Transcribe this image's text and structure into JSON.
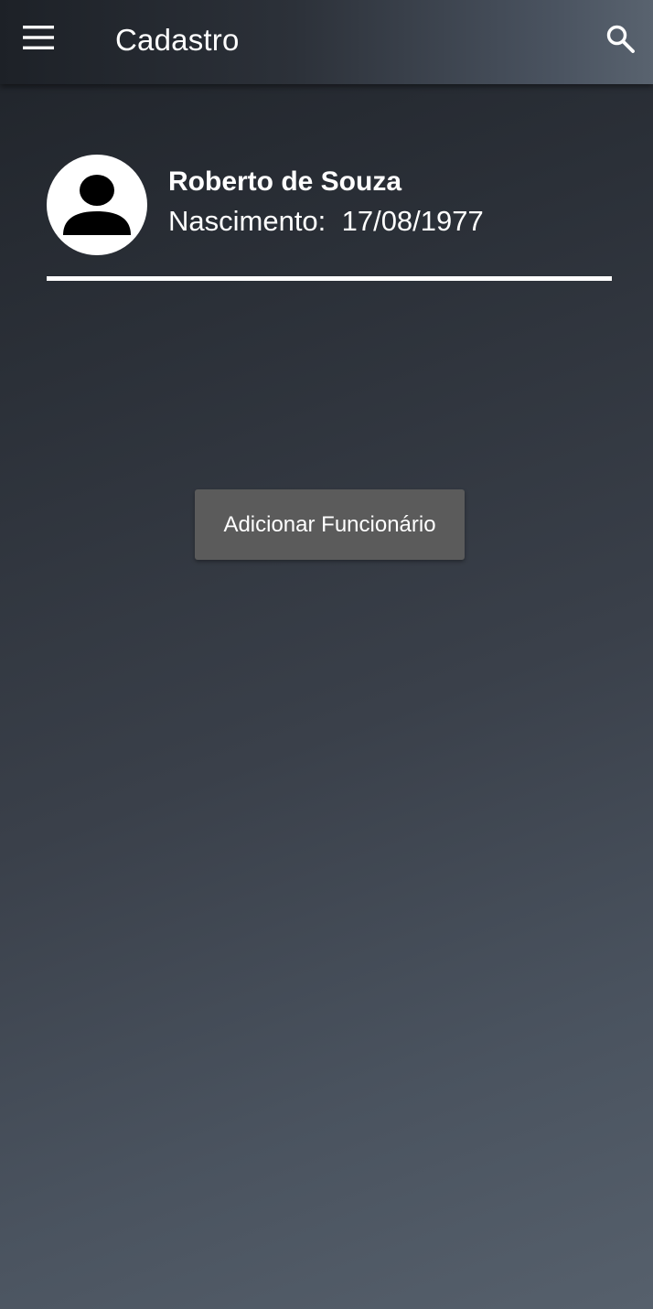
{
  "app_bar": {
    "title": "Cadastro",
    "menu_icon": "hamburger-menu-icon",
    "search_icon": "search-icon"
  },
  "profile": {
    "name": "Roberto de Souza",
    "birth_label": "Nascimento:",
    "birth_date": "17/08/1977",
    "avatar_icon": "person-icon"
  },
  "actions": {
    "add_employee_label": "Adicionar Funcionário"
  },
  "colors": {
    "button_bg": "#5b5b5b",
    "text": "#ffffff",
    "avatar_bg": "#ffffff"
  }
}
